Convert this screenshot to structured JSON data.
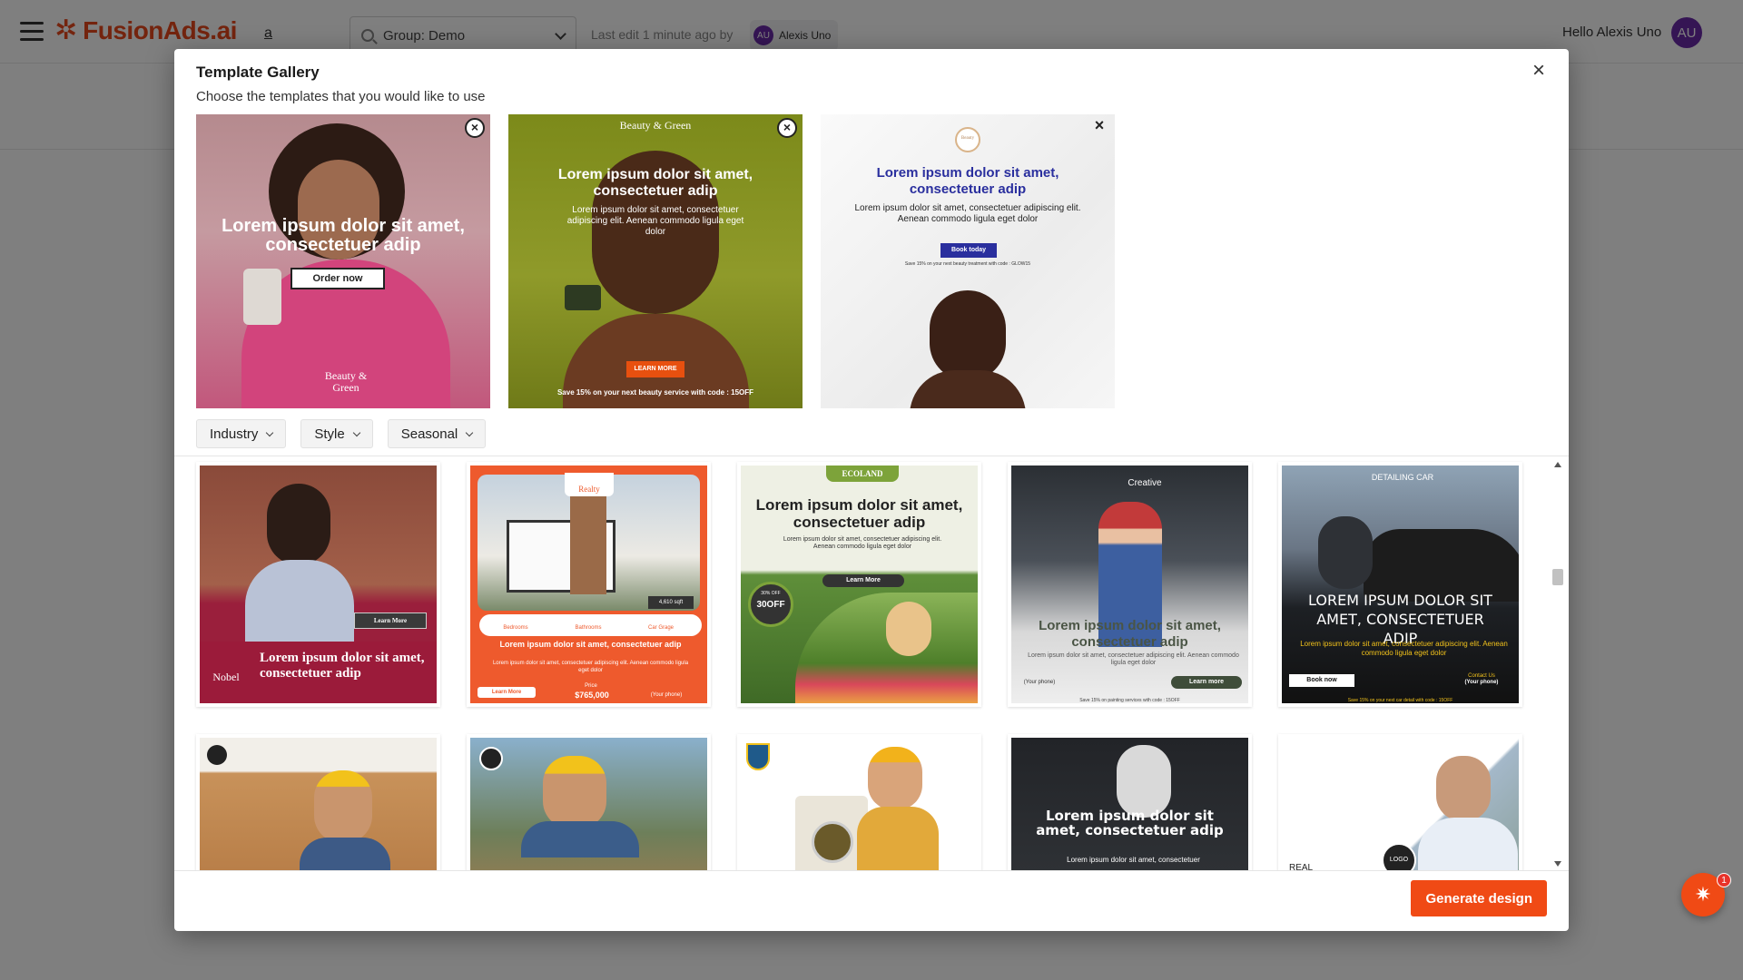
{
  "app": {
    "brand": "FusionAds.ai",
    "nav_letter": "a",
    "group_select": "Group: Demo",
    "last_edit": "Last edit 1 minute ago by",
    "editor_initials": "AU",
    "editor_name": "Alexis Uno",
    "greeting": "Hello Alexis Uno",
    "user_initials": "AU",
    "fab_badge": "1"
  },
  "colors": {
    "brand": "#e8481d",
    "primary_button": "#f04a15",
    "avatar": "#6a2aa8"
  },
  "modal": {
    "title": "Template Gallery",
    "subtitle": "Choose the templates that you would like to use",
    "generate_label": "Generate design",
    "filters": [
      {
        "label": "Industry"
      },
      {
        "label": "Style"
      },
      {
        "label": "Seasonal"
      }
    ],
    "selected": [
      {
        "headline": "Lorem ipsum dolor sit amet, consectetuer adip",
        "cta": "Order now",
        "brand": "Beauty & Green"
      },
      {
        "brand": "Beauty & Green",
        "headline": "Lorem ipsum dolor sit amet, consectetuer adip",
        "body": "Lorem ipsum dolor sit amet, consectetuer adipiscing elit. Aenean commodo ligula eget dolor",
        "cta": "LEARN MORE",
        "footer": "Save 15% on your next beauty service with code : 15OFF"
      },
      {
        "brand": "Beauty",
        "headline": "Lorem ipsum dolor sit amet, consectetuer adip",
        "body": "Lorem ipsum dolor sit amet, consectetuer adipiscing elit. Aenean commodo ligula eget dolor",
        "cta": "Book today",
        "footer": "Save 15% on your next beauty treatment with code : GLOW15"
      }
    ],
    "gallery": [
      {
        "brand": "Nobel",
        "cta": "Learn More",
        "headline": "Lorem ipsum dolor sit amet, consectetuer adip"
      },
      {
        "brand": "Realty",
        "sqft": "4,610 sqft",
        "feature1": "Bedrooms",
        "feature2": "Bathrooms",
        "feature3": "Car Grage",
        "headline": "Lorem ipsum dolor sit amet, consectetuer adip",
        "body": "Lorem ipsum dolor sit amet, consectetuer adipiscing elit. Aenean commodo ligula eget dolor",
        "cta": "Learn More",
        "price_label": "Price",
        "price": "$765,000",
        "phone": "(Your phone)"
      },
      {
        "brand": "ECOLAND",
        "headline": "Lorem ipsum dolor sit amet, consectetuer adip",
        "body": "Lorem ipsum dolor sit amet, consectetuer adipiscing elit. Aenean commodo ligula eget dolor",
        "cta": "Learn More",
        "badge_top": "30% OFF",
        "badge_main": "30OFF"
      },
      {
        "brand": "Creative",
        "headline": "Lorem ipsum dolor sit amet, consectetuer adip",
        "body": "Lorem ipsum dolor sit amet, consectetuer adipiscing elit. Aenean commodo ligula eget dolor",
        "cta": "Learn more",
        "phone": "(Your phone)",
        "footer": "Save 15% on painting services with code : 15OFF"
      },
      {
        "brand": "DETAILING CAR",
        "headline": "LOREM IPSUM DOLOR SIT AMET, CONSECTETUER ADIP",
        "body": "Lorem ipsum dolor sit amet, consectetuer adipiscing elit. Aenean commodo ligula eget dolor",
        "cta": "Book now",
        "contact": "Contact Us",
        "phone": "(Your phone)",
        "footer": "Save 15% on your next car detail with code : 15OFF"
      },
      {},
      {},
      {},
      {
        "headline": "Lorem ipsum dolor sit amet, consectetuer adip",
        "body": "Lorem ipsum dolor sit amet, consectetuer"
      },
      {
        "logo": "LOGO",
        "partial": "REAL"
      }
    ]
  }
}
